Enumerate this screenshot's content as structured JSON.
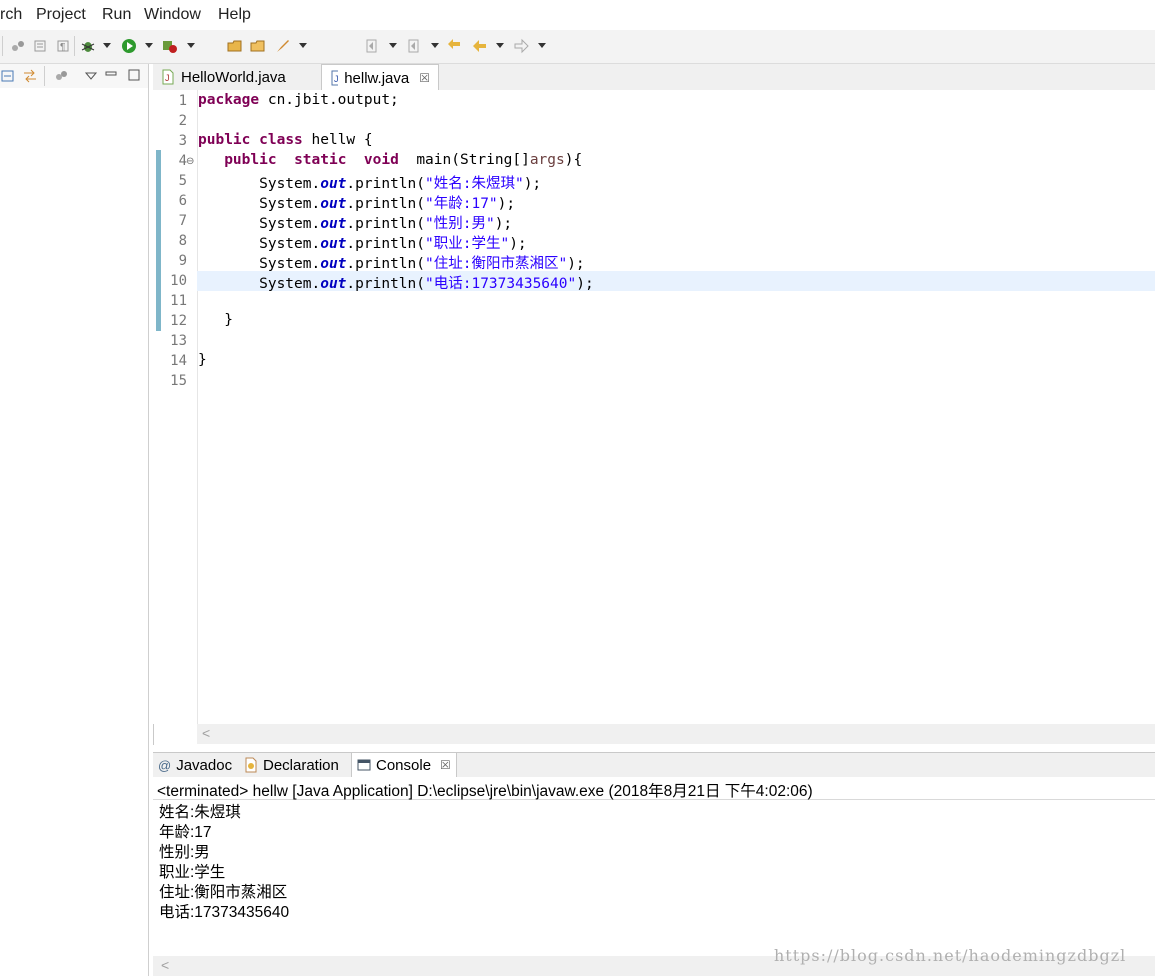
{
  "menu": [
    "rch",
    "Project",
    "Run",
    "Window",
    "Help"
  ],
  "editor": {
    "tabs": [
      {
        "label": "HelloWorld.java",
        "active": false
      },
      {
        "label": "hellw.java",
        "active": true,
        "close": "☒"
      }
    ],
    "line_numbers": [
      "1",
      "2",
      "3",
      "4",
      "5",
      "6",
      "7",
      "8",
      "9",
      "10",
      "11",
      "12",
      "13",
      "14",
      "15"
    ],
    "code": {
      "l1": {
        "kw": "package",
        "rest": " cn.jbit.output;"
      },
      "l3": {
        "kw1": "public",
        "kw2": "class",
        "rest": " hellw {"
      },
      "l4": {
        "indent": "   ",
        "kw1": "public",
        "kw2": "static",
        "kw3": "void",
        "mid": "main(String[]",
        "param": "args",
        "end": "){"
      },
      "sys": "System.",
      "out": "out",
      "println_open": ".println(",
      "close": ");",
      "strings": [
        "\"姓名:朱煜琪\"",
        "\"年龄:17\"",
        "\"性别:男\"",
        "\"职业:学生\"",
        "\"住址:衡阳市蒸湘区\"",
        "\"电话:17373435640\""
      ],
      "l12": "}",
      "l14": "}"
    },
    "scroll_arrow": "<"
  },
  "bottom": {
    "tabs": [
      {
        "label": "Javadoc",
        "icon": "@"
      },
      {
        "label": "Declaration"
      },
      {
        "label": "Console",
        "active": true,
        "close": "☒"
      }
    ],
    "console_status": "<terminated> hellw [Java Application] D:\\eclipse\\jre\\bin\\javaw.exe (2018年8月21日 下午4:02:06)",
    "console_lines": [
      "姓名:朱煜琪",
      "年龄:17",
      "性别:男",
      "职业:学生",
      "住址:衡阳市蒸湘区",
      "电话:17373435640"
    ],
    "scroll_arrow": "<"
  },
  "watermark": "https://blog.csdn.net/haodemingzdbgzl",
  "colors": {
    "keyword": "#7f0055",
    "string": "#2a00ff",
    "field": "#0000c0",
    "highlight": "#e8f2fe"
  }
}
